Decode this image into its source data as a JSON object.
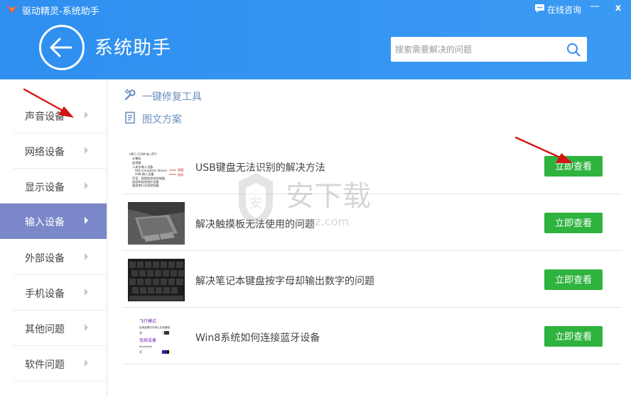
{
  "window": {
    "title": "驱动精灵-系统助手",
    "chat_label": "在线咨询",
    "minimize": "—",
    "close": "x"
  },
  "header": {
    "page_title": "系统助手"
  },
  "search": {
    "placeholder": "搜索需要解决的问题"
  },
  "sidebar": {
    "items": [
      {
        "label": "声音设备",
        "active": false
      },
      {
        "label": "网络设备",
        "active": false
      },
      {
        "label": "显示设备",
        "active": false
      },
      {
        "label": "输入设备",
        "active": true
      },
      {
        "label": "外部设备",
        "active": false
      },
      {
        "label": "手机设备",
        "active": false
      },
      {
        "label": "其他问题",
        "active": false
      },
      {
        "label": "软件问题",
        "active": false
      }
    ]
  },
  "links": {
    "quick_tool": "一键修复工具",
    "guide": "图文方案"
  },
  "articles": [
    {
      "title": "USB键盘无法识别的解决方法",
      "button": "立即查看"
    },
    {
      "title": "解决触摸板无法使用的问题",
      "button": "立即查看"
    },
    {
      "title": "解决笔记本键盘按字母却输出数字的问题",
      "button": "立即查看"
    },
    {
      "title": "Win8系统如何连接蓝牙设备",
      "button": "立即查看"
    }
  ],
  "thumb1": {
    "lines": [
      "(MC) (COM 和 LPT)",
      "计算机",
      "监视器",
      "人体学输入设备",
      "HID-compliant device",
      "USB 输入设备",
      "声音、视频和游戏控制器",
      "鼠标和其他指针设备",
      "通用串行总线控制器"
    ],
    "tag1": "键盘",
    "tag2": "鼠标"
  },
  "thumb4": {
    "mode_title": "飞行模式",
    "mode_desc": "启用此模式可停止无线通信",
    "mode_state": "关",
    "wireless_title": "无线设备",
    "bluetooth": "Bluetooth",
    "bt_state": "开"
  },
  "watermark": {
    "cn": "安下载",
    "url": "anxz.com"
  },
  "colors": {
    "header": "#2f8ff0",
    "active_item": "#7a88c9",
    "button": "#2fb33f",
    "link": "#6b8fc0"
  }
}
